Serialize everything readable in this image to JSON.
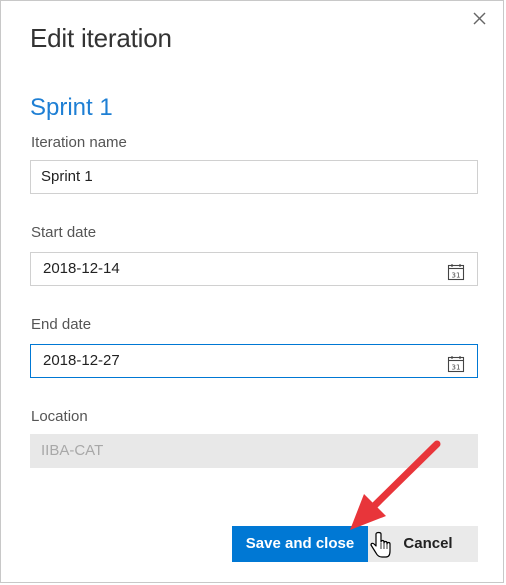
{
  "dialog": {
    "title": "Edit iteration",
    "iteration_heading": "Sprint 1",
    "close_icon": "close-icon"
  },
  "fields": {
    "name": {
      "label": "Iteration name",
      "value": "Sprint 1"
    },
    "start_date": {
      "label": "Start date",
      "value": "2018-12-14",
      "icon": "calendar-icon",
      "icon_text": "31"
    },
    "end_date": {
      "label": "End date",
      "value": "2018-12-27",
      "icon": "calendar-icon",
      "icon_text": "31"
    },
    "location": {
      "label": "Location",
      "value": "IIBA-CAT"
    }
  },
  "buttons": {
    "save": "Save and close",
    "cancel": "Cancel"
  },
  "colors": {
    "accent": "#0078d4",
    "heading_blue": "#1e7fd4",
    "annotation_arrow": "#e8353a"
  }
}
